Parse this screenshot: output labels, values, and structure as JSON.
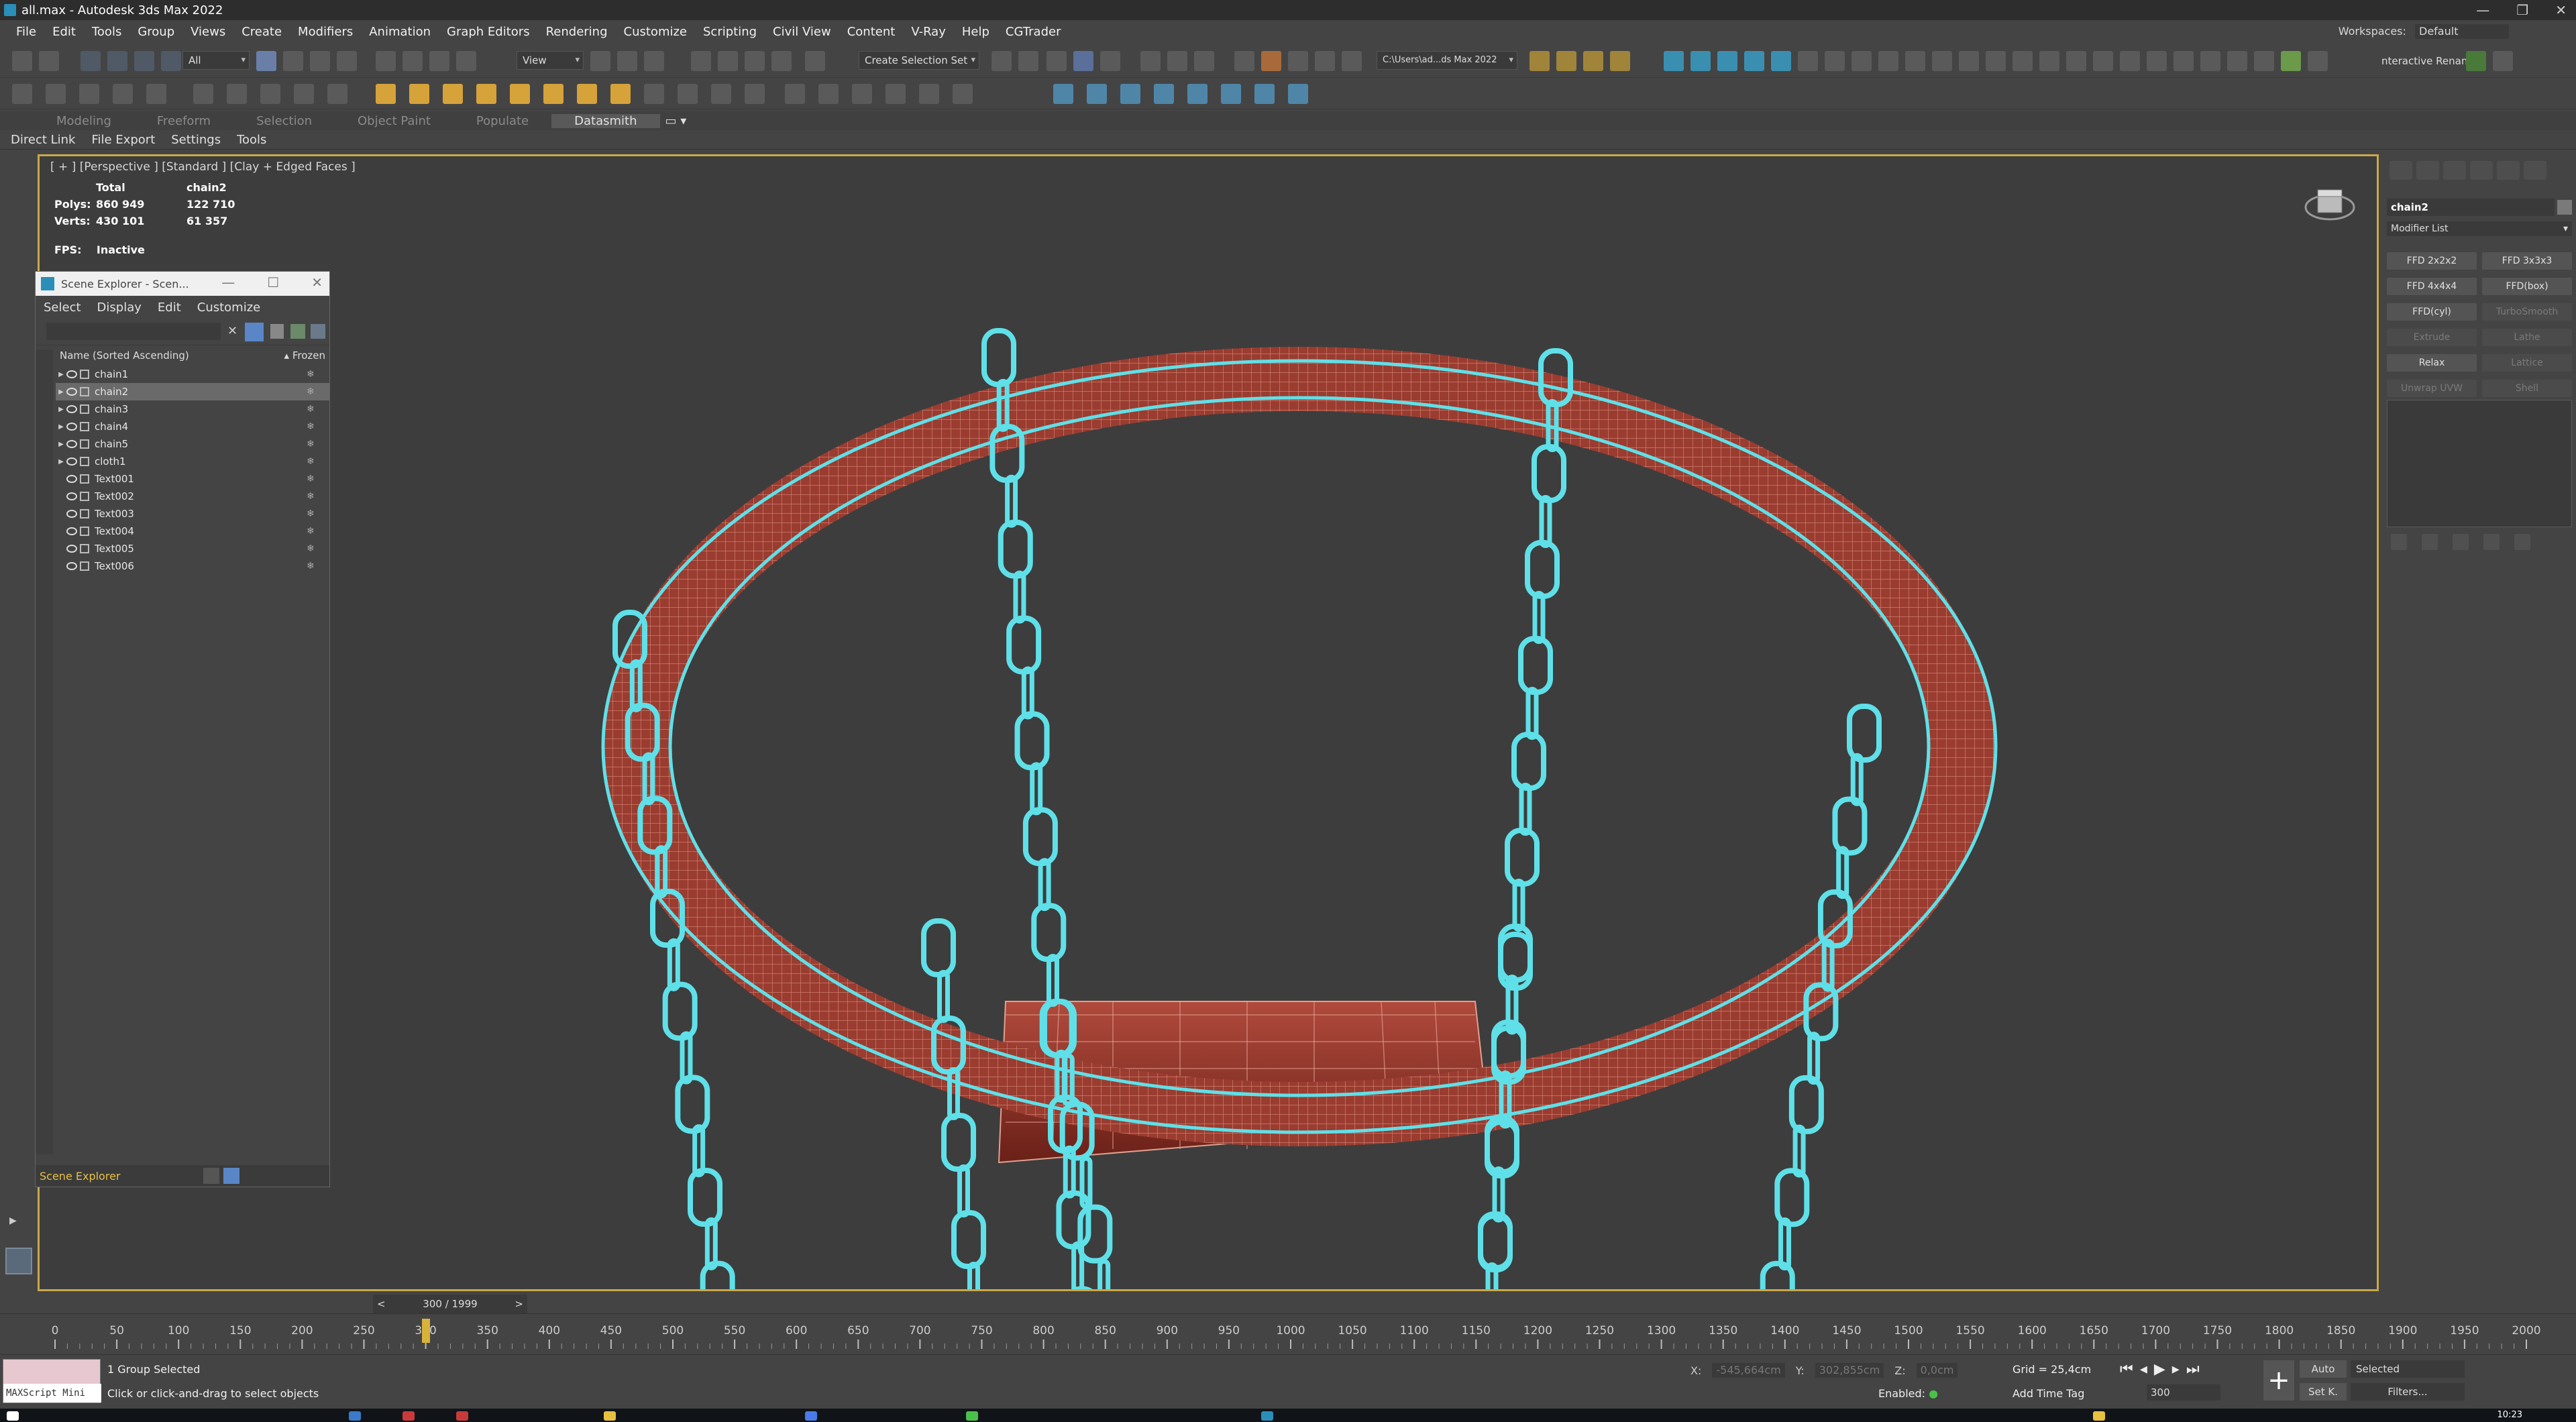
{
  "window": {
    "title": "all.max - Autodesk 3ds Max 2022"
  },
  "menu": [
    "File",
    "Edit",
    "Tools",
    "Group",
    "Views",
    "Create",
    "Modifiers",
    "Animation",
    "Graph Editors",
    "Rendering",
    "Customize",
    "Scripting",
    "Civil View",
    "Content",
    "V-Ray",
    "Help",
    "CGTrader"
  ],
  "workspaces": {
    "label": "Workspaces:",
    "value": "Default"
  },
  "toolbar": {
    "filter": "All",
    "refcoord": "View",
    "selection_set": "Create Selection Set",
    "project_path": "C:\\Users\\ad...ds Max 2022",
    "interactive": "nteractive Renan"
  },
  "ribbon": {
    "tabs": [
      "Modeling",
      "Freeform",
      "Selection",
      "Object Paint",
      "Populate",
      "Datasmith"
    ],
    "active": "Datasmith"
  },
  "subbar": [
    "Direct Link",
    "File Export",
    "Settings",
    "Tools"
  ],
  "viewport": {
    "label": "[ + ] [Perspective ] [Standard ] [Clay + Edged Faces ]",
    "stats": {
      "total": "Total",
      "object": "chain2",
      "polys_label": "Polys:",
      "polys_total": "860 949",
      "polys_obj": "122 710",
      "verts_label": "Verts:",
      "verts_total": "430 101",
      "verts_obj": "61 357"
    },
    "fps_label": "FPS:",
    "fps_value": "Inactive"
  },
  "scene_explorer": {
    "title": "Scene Explorer - Scen...",
    "menu": [
      "Select",
      "Display",
      "Edit",
      "Customize"
    ],
    "col_name": "Name (Sorted Ascending)",
    "col_frozen": "▴ Frozen",
    "rows": [
      {
        "name": "chain1",
        "expandable": true,
        "selected": false
      },
      {
        "name": "chain2",
        "expandable": true,
        "selected": true
      },
      {
        "name": "chain3",
        "expandable": true,
        "selected": false
      },
      {
        "name": "chain4",
        "expandable": true,
        "selected": false
      },
      {
        "name": "chain5",
        "expandable": true,
        "selected": false
      },
      {
        "name": "cloth1",
        "expandable": true,
        "selected": false
      },
      {
        "name": "Text001",
        "expandable": false,
        "selected": false
      },
      {
        "name": "Text002",
        "expandable": false,
        "selected": false
      },
      {
        "name": "Text003",
        "expandable": false,
        "selected": false
      },
      {
        "name": "Text004",
        "expandable": false,
        "selected": false
      },
      {
        "name": "Text005",
        "expandable": false,
        "selected": false
      },
      {
        "name": "Text006",
        "expandable": false,
        "selected": false
      }
    ],
    "footer": "Scene Explorer"
  },
  "command_panel": {
    "object_name": "chain2",
    "modifier_list": "Modifier List",
    "buttons": [
      {
        "label": "FFD 2x2x2",
        "enabled": true
      },
      {
        "label": "FFD 3x3x3",
        "enabled": true
      },
      {
        "label": "FFD 4x4x4",
        "enabled": true
      },
      {
        "label": "FFD(box)",
        "enabled": true
      },
      {
        "label": "FFD(cyl)",
        "enabled": true
      },
      {
        "label": "TurboSmooth",
        "enabled": false
      },
      {
        "label": "Extrude",
        "enabled": false
      },
      {
        "label": "Lathe",
        "enabled": false
      },
      {
        "label": "Relax",
        "enabled": true
      },
      {
        "label": "Lattice",
        "enabled": false
      },
      {
        "label": "Unwrap UVW",
        "enabled": false
      },
      {
        "label": "Shell",
        "enabled": false
      }
    ]
  },
  "timeline": {
    "frame_display": "300 / 1999",
    "current_frame": 300,
    "total_frames": 1999,
    "ticks": [
      "0",
      "50",
      "100",
      "150",
      "200",
      "250",
      "300",
      "350",
      "400",
      "450",
      "500",
      "550",
      "600",
      "650",
      "700",
      "750",
      "800",
      "850",
      "900",
      "950",
      "1000",
      "1050",
      "1100",
      "1150",
      "1200",
      "1250",
      "1300",
      "1350",
      "1400",
      "1450",
      "1500",
      "1550",
      "1600",
      "1650",
      "1700",
      "1750",
      "1800",
      "1850",
      "1900",
      "1950",
      "2000"
    ]
  },
  "status": {
    "maxscript": "MAXScript Mini",
    "selection": "1 Group Selected",
    "hint": "Click or click-and-drag to select objects",
    "x_label": "X:",
    "x_value": "-545,664cm",
    "y_label": "Y:",
    "y_value": "302,855cm",
    "z_label": "Z:",
    "z_value": "0,0cm",
    "grid": "Grid = 25,4cm",
    "enabled": "Enabled:",
    "add_time_tag": "Add Time Tag",
    "frame": "300",
    "auto": "Auto",
    "setk": "Set K.",
    "selected": "Selected",
    "filters": "Filters..."
  },
  "clock": "10:23",
  "colors": {
    "accent": "#caa84a",
    "wire": "#5fe0e8",
    "hoop": "#9a3c30"
  }
}
